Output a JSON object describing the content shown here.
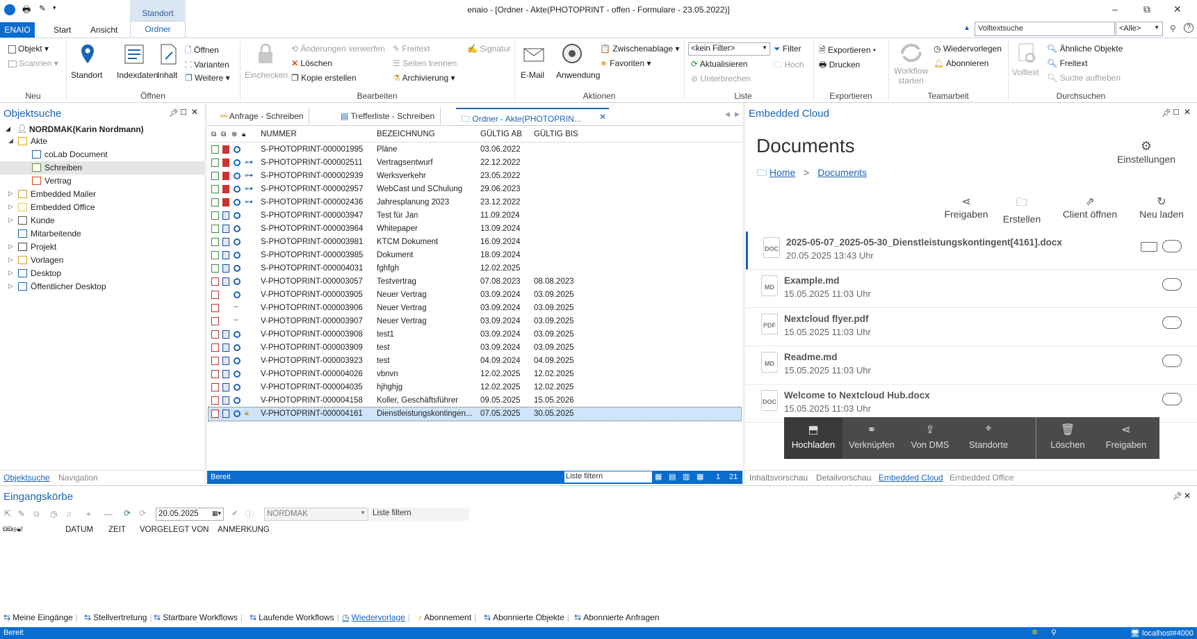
{
  "window": {
    "title": "enaio  - [Ordner - Akte(PHOTOPRINT - offen - Formulare - 23.05.2022)]",
    "min": "–",
    "max": "⧉",
    "close": "✕"
  },
  "ribbon_tabs": {
    "enaio": "ENAIO",
    "start": "Start",
    "ansicht": "Ansicht",
    "context_group": "Standort",
    "ordner": "Ordner"
  },
  "search": {
    "placeholder": "Volltextsuche",
    "scope": "<Alle>"
  },
  "ribbon": {
    "neu": {
      "label": "Neu",
      "objekt": "Objekt",
      "scannen": "Scannen"
    },
    "oeffnen": {
      "label": "Öffnen",
      "standort": "Standort",
      "indexdaten": "Indexdaten",
      "inhalt": "Inhalt",
      "oeffnen": "Öffnen",
      "varianten": "Varianten",
      "weitere": "Weitere"
    },
    "bearbeiten": {
      "label": "Bearbeiten",
      "einchecken": "Einchecken",
      "aenderungen": "Änderungen verwerfen",
      "loeschen": "Löschen",
      "kopie": "Kopie erstellen",
      "freitext": "Freitext",
      "seiten": "Seiten trennen",
      "archivierung": "Archivierung",
      "signatur": "Signatur"
    },
    "aktionen": {
      "label": "Aktionen",
      "email": "E-Mail",
      "anwendung": "Anwendung",
      "zwischenablage": "Zwischenablage",
      "favoriten": "Favoriten"
    },
    "liste": {
      "label": "Liste",
      "filter_value": "<kein Filter>",
      "filter": "Filter",
      "aktualisieren": "Aktualisieren",
      "hoch": "Hoch",
      "unterbrechen": "Unterbrechen"
    },
    "exportieren": {
      "label": "Exportieren",
      "exportieren": "Exportieren",
      "drucken": "Drucken"
    },
    "teamarbeit": {
      "label": "Teamarbeit",
      "workflow1": "Workflow",
      "workflow2": "starten",
      "wiedervorlegen": "Wiedervorlegen",
      "abonnieren": "Abonnieren"
    },
    "durchsuchen": {
      "label": "Durchsuchen",
      "volltext": "Volltext",
      "aehnliche": "Ähnliche Objekte",
      "freitext": "Freitext",
      "suche_aufheben": "Suche aufheben"
    }
  },
  "objektsuche": {
    "title": "Objektsuche",
    "user": "NORDMAK(Karin Nordmann)",
    "items": [
      "Akte",
      "coLab Document",
      "Schreiben",
      "Vertrag",
      "Embedded Mailer",
      "Embedded Office",
      "Kunde",
      "Mitarbeitende",
      "Projekt",
      "Vorlagen",
      "Desktop",
      "Öffentlicher Desktop"
    ],
    "tab_objektsuche": "Objektsuche",
    "tab_navigation": "Navigation"
  },
  "doc_tabs": [
    "Anfrage - Schreiben",
    "Trefferliste - Schreiben",
    "Ordner - Akte(PHOTOPRIN..."
  ],
  "table": {
    "columns": [
      "NUMMER",
      "BEZEICHNUNG",
      "GÜLTIG AB",
      "GÜLTIG BIS"
    ],
    "rows": [
      [
        "S-PHOTOPRINT-000001995",
        "Pläne",
        "03.06.2022",
        ""
      ],
      [
        "S-PHOTOPRINT-000002511",
        "Vertragsentwurf",
        "22.12.2022",
        ""
      ],
      [
        "S-PHOTOPRINT-000002939",
        "Werksverkehr",
        "23.05.2022",
        ""
      ],
      [
        "S-PHOTOPRINT-000002957",
        "WebCast und SChulung",
        "29.06.2023",
        ""
      ],
      [
        "S-PHOTOPRINT-000002436",
        "Jahresplanung 2023",
        "23.12.2022",
        ""
      ],
      [
        "S-PHOTOPRINT-000003947",
        "Test für Jan",
        "11.09.2024",
        ""
      ],
      [
        "S-PHOTOPRINT-000003964",
        "Whitepaper",
        "13.09.2024",
        ""
      ],
      [
        "S-PHOTOPRINT-000003981",
        "KTCM Dokument",
        "16.09.2024",
        ""
      ],
      [
        "S-PHOTOPRINT-000003985",
        "Dokument",
        "18.09.2024",
        ""
      ],
      [
        "S-PHOTOPRINT-000004031",
        "fghfgh",
        "12.02.2025",
        ""
      ],
      [
        "V-PHOTOPRINT-000003057",
        "Testvertrag",
        "07.08.2023",
        "08.08.2023"
      ],
      [
        "V-PHOTOPRINT-000003905",
        "Neuer Vertrag",
        "03.09.2024",
        "03.09.2025"
      ],
      [
        "V-PHOTOPRINT-000003906",
        "Neuer Vertrag",
        "03.09.2024",
        "03.09.2025"
      ],
      [
        "V-PHOTOPRINT-000003907",
        "Neuer Vertrag",
        "03.09.2024",
        "03.09.2025"
      ],
      [
        "V-PHOTOPRINT-000003908",
        "test1",
        "03.09.2024",
        "03.09.2025"
      ],
      [
        "V-PHOTOPRINT-000003909",
        "test",
        "03.09.2024",
        "03.09.2025"
      ],
      [
        "V-PHOTOPRINT-000003923",
        "test",
        "04.09.2024",
        "04.09.2025"
      ],
      [
        "V-PHOTOPRINT-000004026",
        "vbnvn",
        "12.02.2025",
        "12.02.2025"
      ],
      [
        "V-PHOTOPRINT-000004035",
        "hjhghjg",
        "12.02.2025",
        "12.02.2025"
      ],
      [
        "V-PHOTOPRINT-000004158",
        "Koller, Geschäftsführer",
        "09.05.2025",
        "15.05.2026"
      ],
      [
        "V-PHOTOPRINT-000004161",
        "Dienstleistungskontingen...",
        "07.05.2025",
        "30.05.2025"
      ]
    ]
  },
  "list_status": {
    "text": "Bereit",
    "filter": "Liste filtern",
    "page": "1",
    "count": "21"
  },
  "cloud": {
    "panel_title": "Embedded Cloud",
    "heading": "Documents",
    "settings": "Einstellungen",
    "crumb_home": "Home",
    "crumb_docs": "Documents",
    "actions": [
      "Freigaben",
      "Erstellen",
      "Client öffnen",
      "Neu laden"
    ],
    "files": [
      {
        "type": "DOC",
        "name": "2025-05-07_2025-05-30_Dienstleistungskontingent[4161].docx",
        "date": "20.05.2025 13:43 Uhr"
      },
      {
        "type": "MD",
        "name": "Example.md",
        "date": "15.05.2025 11:03 Uhr"
      },
      {
        "type": "PDF",
        "name": "Nextcloud flyer.pdf",
        "date": "15.05.2025 11:03 Uhr"
      },
      {
        "type": "MD",
        "name": "Readme.md",
        "date": "15.05.2025 11:03 Uhr"
      },
      {
        "type": "DOC",
        "name": "Welcome to Nextcloud Hub.docx",
        "date": "15.05.2025 11:03 Uhr"
      }
    ],
    "menu": [
      "Hochladen",
      "Verknüpfen",
      "Von DMS",
      "Standorte",
      "Löschen",
      "Freigaben"
    ],
    "tabs": [
      "Inhaltsvorschau",
      "Detailvorschau",
      "Embedded Cloud",
      "Embedded Office"
    ]
  },
  "inbox": {
    "title": "Eingangskörbe",
    "date": "20.05.2025",
    "user": "NORDMAK",
    "filter": "Liste filtern",
    "columns": [
      "DATUM",
      "ZEIT",
      "VORGELEGT VON",
      "ANMERKUNG"
    ],
    "tabs": [
      "Meine Eingänge",
      "Stellvertretung",
      "Startbare Workflows",
      "Laufende Workflows",
      "Wiedervorlage",
      "Abonnement",
      "Abonnierte Objekte",
      "Abonnierte Anfragen"
    ]
  },
  "status": {
    "text": "Bereit",
    "server": "localhost#4000"
  }
}
